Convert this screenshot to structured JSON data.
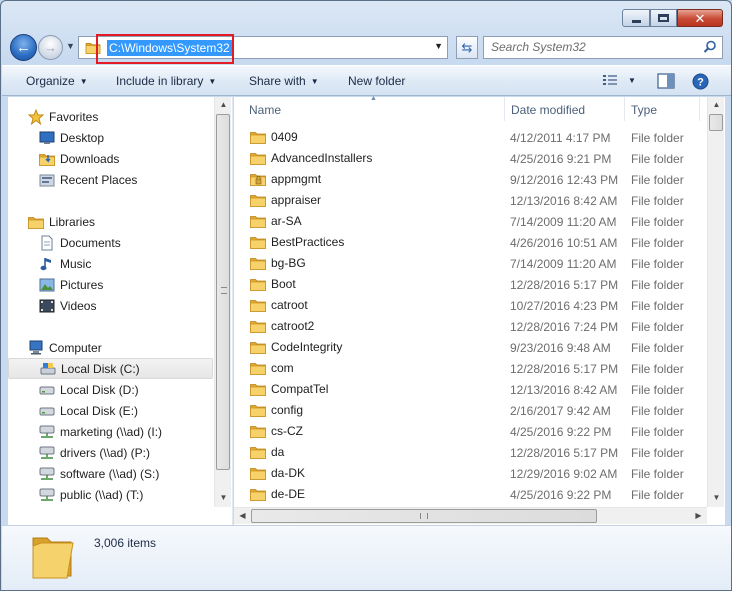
{
  "window": {
    "caption_buttons": [
      "minimize",
      "maximize",
      "close"
    ]
  },
  "address_bar": {
    "path": "C:\\Windows\\System32"
  },
  "search": {
    "placeholder": "Search System32"
  },
  "toolbar": {
    "organize": "Organize",
    "include_in_library": "Include in library",
    "share_with": "Share with",
    "new_folder": "New folder"
  },
  "nav_pane": {
    "favorites": {
      "label": "Favorites",
      "items": [
        "Desktop",
        "Downloads",
        "Recent Places"
      ]
    },
    "libraries": {
      "label": "Libraries",
      "items": [
        "Documents",
        "Music",
        "Pictures",
        "Videos"
      ]
    },
    "computer": {
      "label": "Computer",
      "items": [
        "Local Disk (C:)",
        "Local Disk (D:)",
        "Local Disk (E:)",
        "marketing (\\\\ad) (I:)",
        "drivers (\\\\ad) (P:)",
        "software (\\\\ad) (S:)",
        "public (\\\\ad) (T:)"
      ],
      "selected": "Local Disk (C:)"
    }
  },
  "columns": {
    "name": "Name",
    "date": "Date modified",
    "type": "Type"
  },
  "files": [
    {
      "name": "0409",
      "date": "4/12/2011 4:17 PM",
      "type": "File folder",
      "locked": false
    },
    {
      "name": "AdvancedInstallers",
      "date": "4/25/2016 9:21 PM",
      "type": "File folder",
      "locked": false
    },
    {
      "name": "appmgmt",
      "date": "9/12/2016 12:43 PM",
      "type": "File folder",
      "locked": true
    },
    {
      "name": "appraiser",
      "date": "12/13/2016 8:42 AM",
      "type": "File folder",
      "locked": false
    },
    {
      "name": "ar-SA",
      "date": "7/14/2009 11:20 AM",
      "type": "File folder",
      "locked": false
    },
    {
      "name": "BestPractices",
      "date": "4/26/2016 10:51 AM",
      "type": "File folder",
      "locked": false
    },
    {
      "name": "bg-BG",
      "date": "7/14/2009 11:20 AM",
      "type": "File folder",
      "locked": false
    },
    {
      "name": "Boot",
      "date": "12/28/2016 5:17 PM",
      "type": "File folder",
      "locked": false
    },
    {
      "name": "catroot",
      "date": "10/27/2016 4:23 PM",
      "type": "File folder",
      "locked": false
    },
    {
      "name": "catroot2",
      "date": "12/28/2016 7:24 PM",
      "type": "File folder",
      "locked": false
    },
    {
      "name": "CodeIntegrity",
      "date": "9/23/2016 9:48 AM",
      "type": "File folder",
      "locked": false
    },
    {
      "name": "com",
      "date": "12/28/2016 5:17 PM",
      "type": "File folder",
      "locked": false
    },
    {
      "name": "CompatTel",
      "date": "12/13/2016 8:42 AM",
      "type": "File folder",
      "locked": false
    },
    {
      "name": "config",
      "date": "2/16/2017 9:42 AM",
      "type": "File folder",
      "locked": false
    },
    {
      "name": "cs-CZ",
      "date": "4/25/2016 9:22 PM",
      "type": "File folder",
      "locked": false
    },
    {
      "name": "da",
      "date": "12/28/2016 5:17 PM",
      "type": "File folder",
      "locked": false
    },
    {
      "name": "da-DK",
      "date": "12/29/2016 9:02 AM",
      "type": "File folder",
      "locked": false
    },
    {
      "name": "de-DE",
      "date": "4/25/2016 9:22 PM",
      "type": "File folder",
      "locked": false
    }
  ],
  "status": {
    "item_count": "3,006 items"
  },
  "colors": {
    "selection": "#3399ff",
    "highlight_box": "#e21b24",
    "folder": "#f3c84b"
  }
}
